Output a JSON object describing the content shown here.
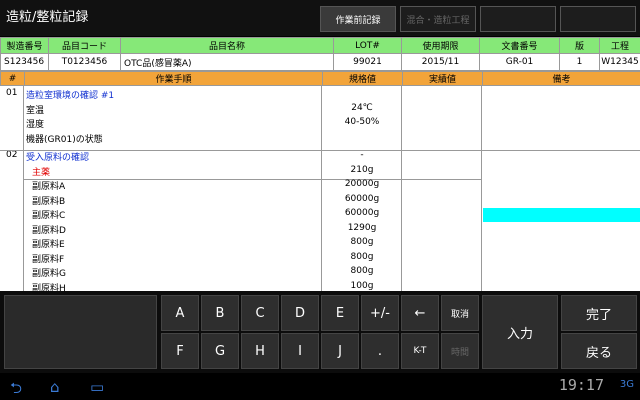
{
  "app": {
    "title": "造粒/整粒記録",
    "tabs": [
      {
        "label": "作業前記録",
        "state": "active"
      },
      {
        "label": "混合・造粒工程",
        "state": "disabled"
      },
      {
        "label": "",
        "state": "empty"
      },
      {
        "label": "",
        "state": "empty"
      }
    ]
  },
  "record_header": {
    "columns": [
      "製造番号",
      "品目コード",
      "品目名称",
      "LOT#",
      "使用期限",
      "文書番号",
      "版",
      "工程"
    ],
    "values": [
      "S123456",
      "T0123456",
      "OTC品(感冒薬A)",
      "99021",
      "2015/11",
      "GR-01",
      "1",
      "W12345"
    ]
  },
  "steps_header": {
    "columns": [
      "#",
      "作業手順",
      "規格値",
      "実績値",
      "備考"
    ]
  },
  "steps": [
    {
      "num": "01",
      "text": "造粒室環境の確認 #1",
      "value": "",
      "style": "blue"
    },
    {
      "num": "",
      "text": "室温",
      "value": "24℃",
      "style": ""
    },
    {
      "num": "",
      "text": "湿度",
      "value": "40-50%",
      "style": ""
    },
    {
      "num": "",
      "text": "機器(GR01)の状態",
      "value": "",
      "style": ""
    },
    {
      "num": "02",
      "text": "受入原料の確認",
      "value": "-",
      "style": "blue"
    },
    {
      "num": "",
      "text": "主薬",
      "value": "210g",
      "style": "red"
    },
    {
      "num": "",
      "text": "副原料A",
      "value": "20000g",
      "style": ""
    },
    {
      "num": "",
      "text": "副原料B",
      "value": "60000g",
      "style": ""
    },
    {
      "num": "",
      "text": "副原料C",
      "value": "60000g",
      "style": ""
    },
    {
      "num": "",
      "text": "副原料D",
      "value": "1290g",
      "style": ""
    },
    {
      "num": "",
      "text": "副原料E",
      "value": "800g",
      "style": ""
    },
    {
      "num": "",
      "text": "副原料F",
      "value": "800g",
      "style": ""
    },
    {
      "num": "",
      "text": "副原料G",
      "value": "800g",
      "style": ""
    },
    {
      "num": "",
      "text": "副原料H",
      "value": "100g",
      "style": ""
    }
  ],
  "keypad": {
    "row1": [
      "A",
      "B",
      "C",
      "D",
      "E",
      "+/-",
      "←",
      "取消"
    ],
    "row2": [
      "F",
      "G",
      "H",
      "I",
      "J",
      ".",
      "K-T",
      "時間"
    ],
    "enter": "入力",
    "done": "完了",
    "back": "戻る"
  },
  "system": {
    "clock": "19:17",
    "status": "3G"
  },
  "colors": {
    "header_green": "#86e878",
    "header_orange": "#f2a43a",
    "highlight_cyan": "#00ffff",
    "step_blue": "#1030d0",
    "alert_red": "#e00000"
  }
}
